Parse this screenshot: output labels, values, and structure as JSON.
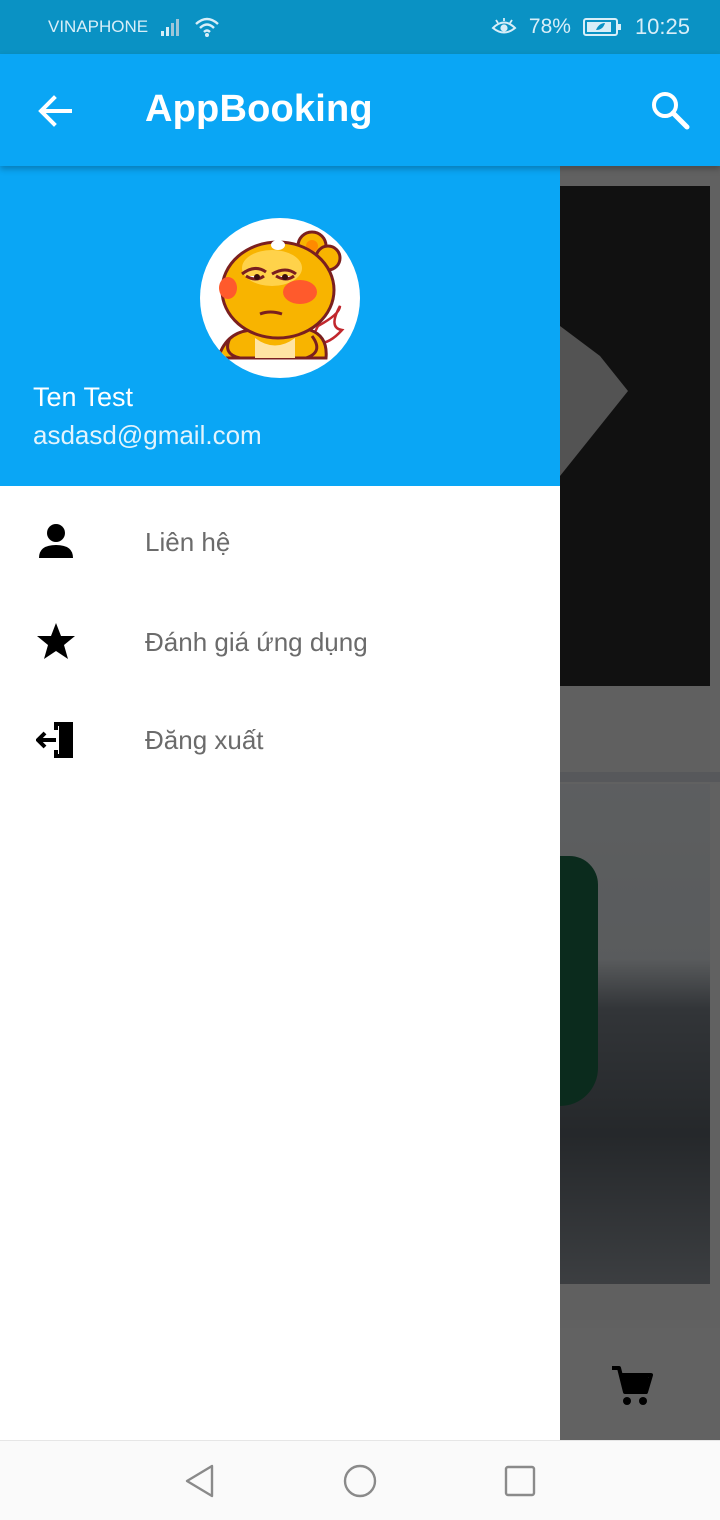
{
  "status_bar": {
    "carrier": "VINAPHONE",
    "battery": "78%",
    "time": "10:25",
    "icons": [
      "signal-icon",
      "wifi-icon",
      "eye-comfort-icon",
      "battery-icon"
    ]
  },
  "app_bar": {
    "title": "AppBooking",
    "back_icon": "arrow-left-icon",
    "search_icon": "search-icon",
    "color": "#0aa6f5"
  },
  "drawer": {
    "header": {
      "user_name": "Ten Test",
      "user_email": "asdasd@gmail.com",
      "avatar_icon": "cartoon-mascot-avatar"
    },
    "menu": [
      {
        "label": "Liên hệ",
        "icon": "person-icon"
      },
      {
        "label": "Đánh giá ứng dụng",
        "icon": "star-icon"
      },
      {
        "label": "Đăng xuất",
        "icon": "logout-door-icon"
      }
    ]
  },
  "background": {
    "cart_icon": "cart-icon"
  },
  "nav_bar": {
    "buttons": [
      "back-triangle-icon",
      "home-circle-icon",
      "recents-square-icon"
    ]
  }
}
